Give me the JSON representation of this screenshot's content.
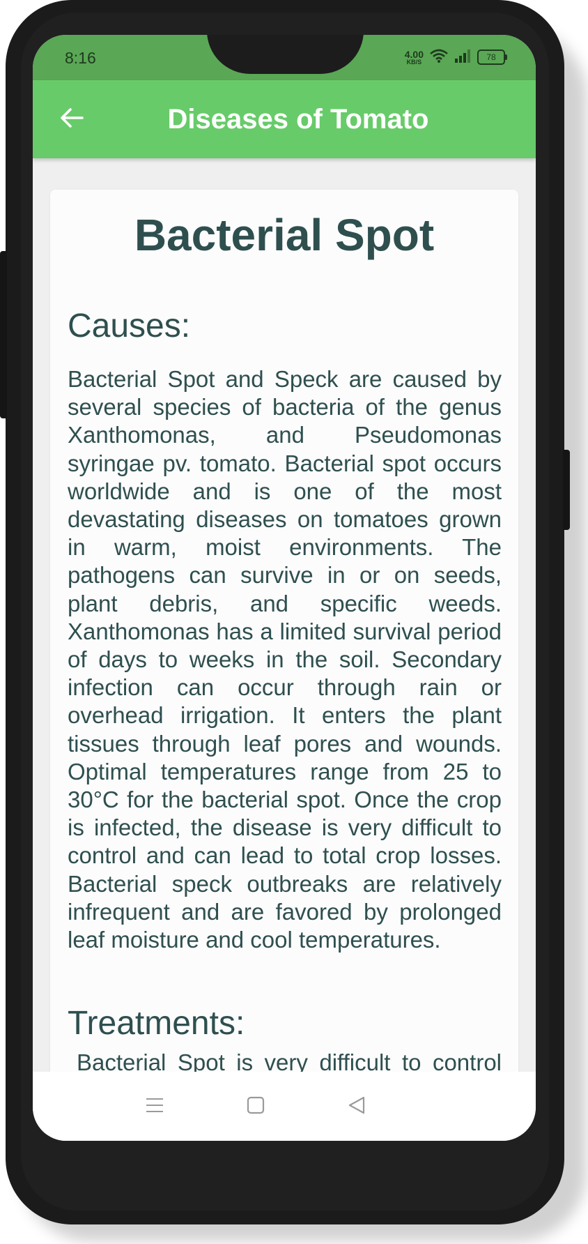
{
  "status_bar": {
    "time": "8:16",
    "net_speed": "4.00",
    "net_speed_unit": "KB/S",
    "battery": "78"
  },
  "app_bar": {
    "title": "Diseases of Tomato",
    "back_icon": "arrow-left-icon"
  },
  "disease": {
    "name": "Bacterial Spot",
    "causes_heading": "Causes:",
    "causes_text": "Bacterial Spot and Speck are caused by several species of bacteria of the genus Xanthomonas, and Pseudomonas syringae pv. tomato. Bacterial spot occurs worldwide and is one of the most devastating diseases on tomatoes grown in warm, moist environments. The pathogens can survive in or on seeds, plant debris, and specific weeds. Xanthomonas has a limited survival period of days to weeks in the soil. Secondary infection can occur through rain or overhead irrigation. It enters the plant tissues through leaf pores and wounds. Optimal temperatures range from 25 to 30°C for the bacterial spot. Once the crop is infected, the disease is very difficult to control and can lead to total crop losses. Bacterial speck outbreaks are relatively infrequent and are favored by prolonged leaf moisture and cool temperatures.",
    "treatments_heading": "Treatments:",
    "treatments_text": "Bacterial Spot is very difficult to control"
  },
  "nav_bar": {
    "icons": [
      "menu-icon",
      "home-square-icon",
      "back-triangle-icon"
    ]
  },
  "colors": {
    "status_bar": "#5aa755",
    "app_bar": "#67cb69",
    "text": "#2f4f4f",
    "screen_bg": "#efefef"
  }
}
